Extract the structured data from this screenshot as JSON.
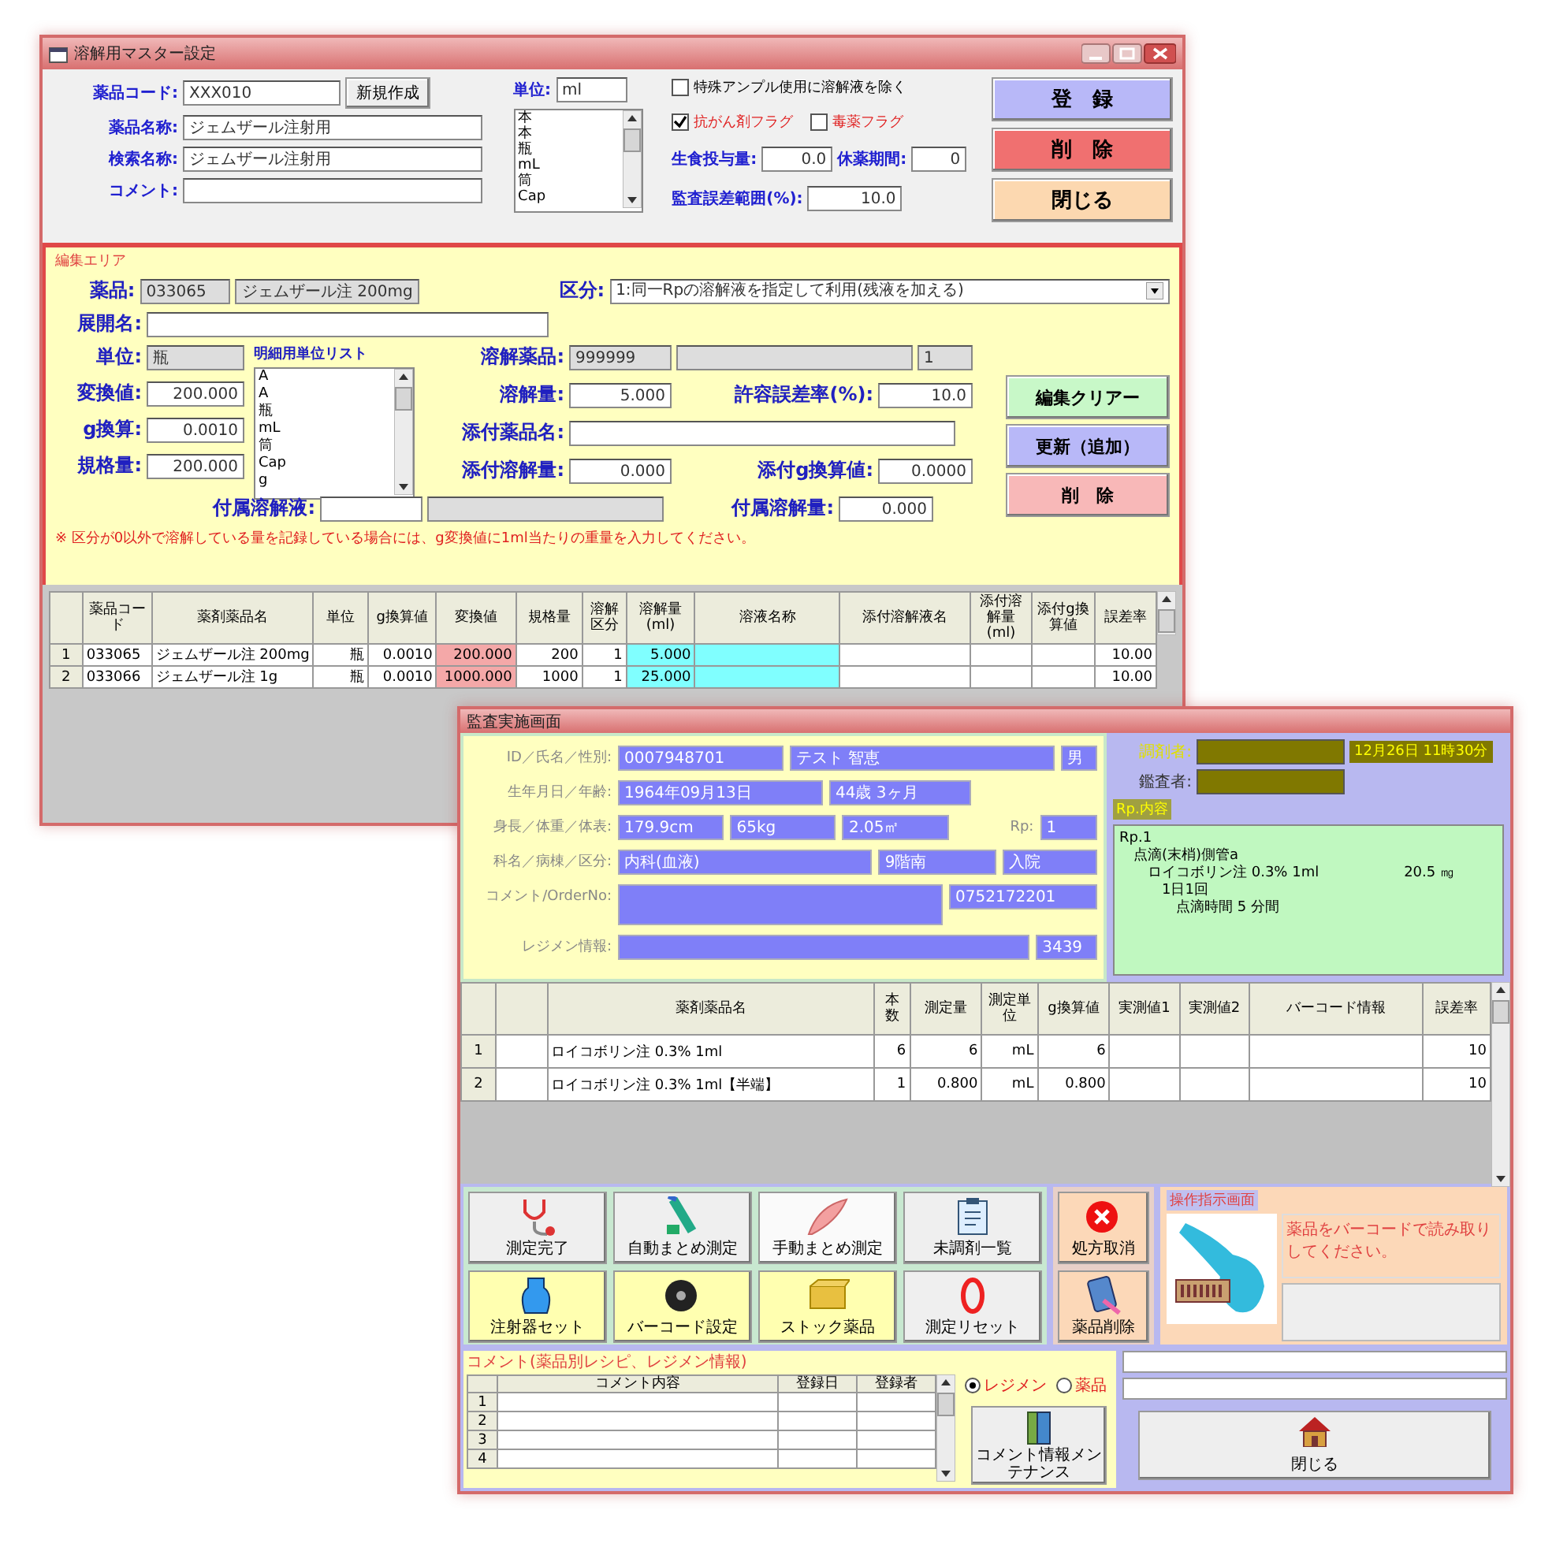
{
  "w1": {
    "title": "溶解用マスター設定",
    "top": {
      "code": {
        "label": "薬品コード:",
        "value": "XXX010"
      },
      "new_button": "新規作成",
      "name": {
        "label": "薬品名称:",
        "value": "ジェムザール注射用"
      },
      "search": {
        "label": "検索名称:",
        "value": "ジェムザール注射用"
      },
      "comment": {
        "label": "コメント:"
      },
      "unit": {
        "label": "単位:",
        "value": "ml"
      },
      "unit_list": [
        "本",
        "本",
        "瓶",
        "mL",
        "筒",
        "Cap"
      ],
      "checks": [
        {
          "label": "特殊アンプル使用に溶解液を除く",
          "checked": false
        },
        {
          "label": "抗がん剤フラグ",
          "checked": true
        },
        {
          "label": "毒薬フラグ",
          "checked": false
        }
      ],
      "saline": {
        "label": "生食投与量:",
        "value": "0.0"
      },
      "rest": {
        "label": "休薬期間:",
        "value": "0"
      },
      "audit": {
        "label": "監査誤差範囲(%):",
        "value": "10.0"
      },
      "buttons": [
        "登　録",
        "削　除",
        "閉じる"
      ]
    },
    "edit": {
      "title": "編集エリア",
      "drug": {
        "label": "薬品:",
        "code": "033065",
        "name": "ジェムザール注 200mg"
      },
      "category": {
        "label": "区分:",
        "value": "1:同一Rpの溶解液を指定して利用(残液を加える)"
      },
      "expand": {
        "label": "展開名:"
      },
      "unit": {
        "label": "単位:",
        "value": "瓶"
      },
      "unit_list_label": "明細用単位リスト",
      "unit_list": [
        "A",
        "A",
        "瓶",
        "mL",
        "筒",
        "Cap",
        "g"
      ],
      "convert": {
        "label": "変換値:",
        "value": "200.000"
      },
      "gconv": {
        "label": "g換算:",
        "value": "0.0010"
      },
      "spec": {
        "label": "規格量:",
        "value": "200.000"
      },
      "solvent": {
        "label": "溶解薬品:",
        "code": "999999",
        "count": "1"
      },
      "sol_amount": {
        "label": "溶解量:",
        "value": "5.000"
      },
      "tolerance": {
        "label": "許容誤差率(%):",
        "value": "10.0"
      },
      "att_name": {
        "label": "添付薬品名:"
      },
      "att_amount": {
        "label": "添付溶解量:",
        "value": "0.000"
      },
      "att_g": {
        "label": "添付g換算値:",
        "value": "0.0000"
      },
      "inc_sol": {
        "label": "付属溶解液:"
      },
      "inc_amount": {
        "label": "付属溶解量:",
        "value": "0.000"
      },
      "buttons": [
        "編集クリアー",
        "更新（追加）",
        "削　除"
      ],
      "note": "※ 区分が0以外で溶解している量を記録している場合には、g変換値に1ml当たりの重量を入力してください。"
    },
    "table": {
      "columns": [
        "薬品コード",
        "薬剤薬品名",
        "単位",
        "g換算値",
        "変換値",
        "規格量",
        "溶解区分",
        "溶解量(ml)",
        "溶液名称",
        "添付溶解液名",
        "添付溶解量(ml)",
        "添付g換算値",
        "誤差率"
      ],
      "rows": [
        {
          "number": "1",
          "cells": [
            "033065",
            "ジェムザール注 200mg",
            "瓶",
            "0.0010",
            "200.000",
            "200",
            "1",
            "5.000",
            null,
            null,
            null,
            null,
            "10.00"
          ]
        },
        {
          "number": "2",
          "cells": [
            "033066",
            "ジェムザール注 1g",
            "瓶",
            "0.0010",
            "1000.000",
            "1000",
            "1",
            "25.000",
            null,
            null,
            null,
            null,
            "10.00"
          ]
        }
      ]
    }
  },
  "w2": {
    "title": "監査実施画面",
    "patient": [
      {
        "label": "ID／氏名／性別:",
        "values": [
          "0007948701",
          "テスト 智恵",
          "男"
        ]
      },
      {
        "label": "生年月日／年齢:",
        "values": [
          "1964年09月13日",
          "44歳 3ヶ月"
        ]
      },
      {
        "label": "身長／体重／体表:",
        "values": [
          "179.9cm",
          "65kg",
          "2.05㎡"
        ],
        "rp": {
          "label": "Rp:",
          "value": "1"
        }
      },
      {
        "label": "科名／病棟／区分:",
        "values": [
          "内科(血液)",
          "9階南",
          "入院"
        ]
      },
      {
        "label": "コメント/OrderNo:",
        "kind": "with_blank",
        "values": [
          "0752172201"
        ]
      },
      {
        "label": "レジメン情報:",
        "kind": "with_blank",
        "values": [
          "3439"
        ]
      }
    ],
    "staff": {
      "preparer": "調剤者:",
      "datetime": "12月26日 11時30分",
      "auditor": "鑑査者:"
    },
    "rp_label": "Rp.内容",
    "rp_text": [
      "Rp.1",
      "　点滴(末梢)側管a",
      "　　ロイコボリン注 0.3% 1ml　　　　　　20.5 ㎎",
      "　　　1日1回",
      "　　　　点滴時間 5 分間"
    ],
    "table": {
      "columns": [
        null,
        "薬剤薬品名",
        "本数",
        "測定量",
        "測定単位",
        "g換算値",
        "実測値1",
        "実測値2",
        "バーコード情報",
        "誤差率"
      ],
      "rows": [
        {
          "number": "1",
          "cells": [
            null,
            "ロイコボリン注 0.3% 1ml",
            "6",
            "6",
            "mL",
            "6",
            null,
            null,
            null,
            "10"
          ]
        },
        {
          "number": "2",
          "cells": [
            null,
            "ロイコボリン注 0.3% 1ml【半端】",
            "1",
            "0.800",
            "mL",
            "0.800",
            null,
            null,
            null,
            "10"
          ]
        }
      ]
    },
    "actions": [
      "測定完了",
      "自動まとめ測定",
      "手動まとめ測定",
      "未調剤一覧",
      "注射器セット",
      "バーコード設定",
      "ストック薬品",
      "測定リセット"
    ],
    "side_actions": [
      "処方取消",
      "薬品削除"
    ],
    "instruction": {
      "title": "操作指示画面",
      "message": "薬品をバーコードで読み取りしてください。"
    },
    "comments": {
      "title": "コメント(薬品別レシピ、レジメン情報)",
      "columns": [
        "コメント内容",
        "登録日",
        "登録者"
      ],
      "rows": [
        "1",
        "2",
        "3",
        "4"
      ]
    },
    "radios": [
      {
        "label": "レジメン",
        "selected": true
      },
      {
        "label": "薬品",
        "selected": false
      }
    ],
    "maintenance": "コメント情報メンテナンス",
    "close": "閉じる"
  }
}
